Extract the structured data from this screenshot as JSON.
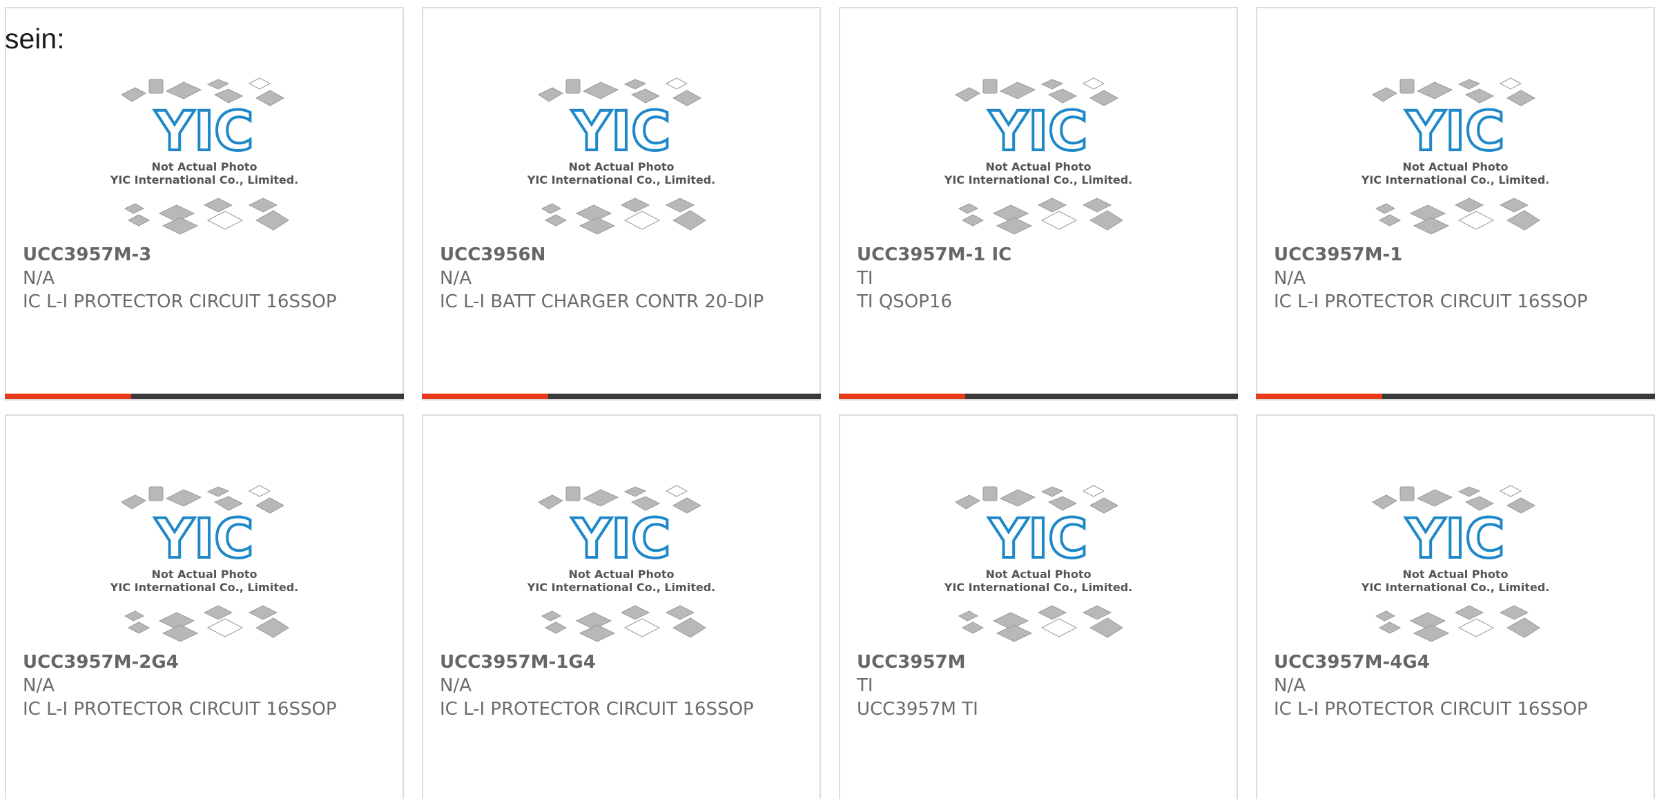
{
  "intro_text": "sein:",
  "placeholder_image": {
    "caption_line1": "Not Actual Photo",
    "caption_line2": "YIC International Co., Limited.",
    "logo_text": "YIC"
  },
  "colors": {
    "accent": "#e8391a",
    "bar": "#3a3a3a",
    "logo_blue": "#1e88c8",
    "text": "#6b6b6b"
  },
  "products": [
    {
      "part_number": "UCC3957M-3",
      "manufacturer": "N/A",
      "description": "IC L-I PROTECTOR CIRCUIT 16SSOP"
    },
    {
      "part_number": "UCC3956N",
      "manufacturer": "N/A",
      "description": "IC L-I BATT CHARGER CONTR 20-DIP"
    },
    {
      "part_number": "UCC3957M-1 IC",
      "manufacturer": "TI",
      "description": "TI QSOP16"
    },
    {
      "part_number": "UCC3957M-1",
      "manufacturer": "N/A",
      "description": "IC L-I PROTECTOR CIRCUIT 16SSOP"
    },
    {
      "part_number": "UCC3957M-2G4",
      "manufacturer": "N/A",
      "description": "IC L-I PROTECTOR CIRCUIT 16SSOP"
    },
    {
      "part_number": "UCC3957M-1G4",
      "manufacturer": "N/A",
      "description": "IC L-I PROTECTOR CIRCUIT 16SSOP"
    },
    {
      "part_number": "UCC3957M",
      "manufacturer": "TI",
      "description": "UCC3957M TI"
    },
    {
      "part_number": "UCC3957M-4G4",
      "manufacturer": "N/A",
      "description": "IC L-I PROTECTOR CIRCUIT 16SSOP"
    }
  ]
}
